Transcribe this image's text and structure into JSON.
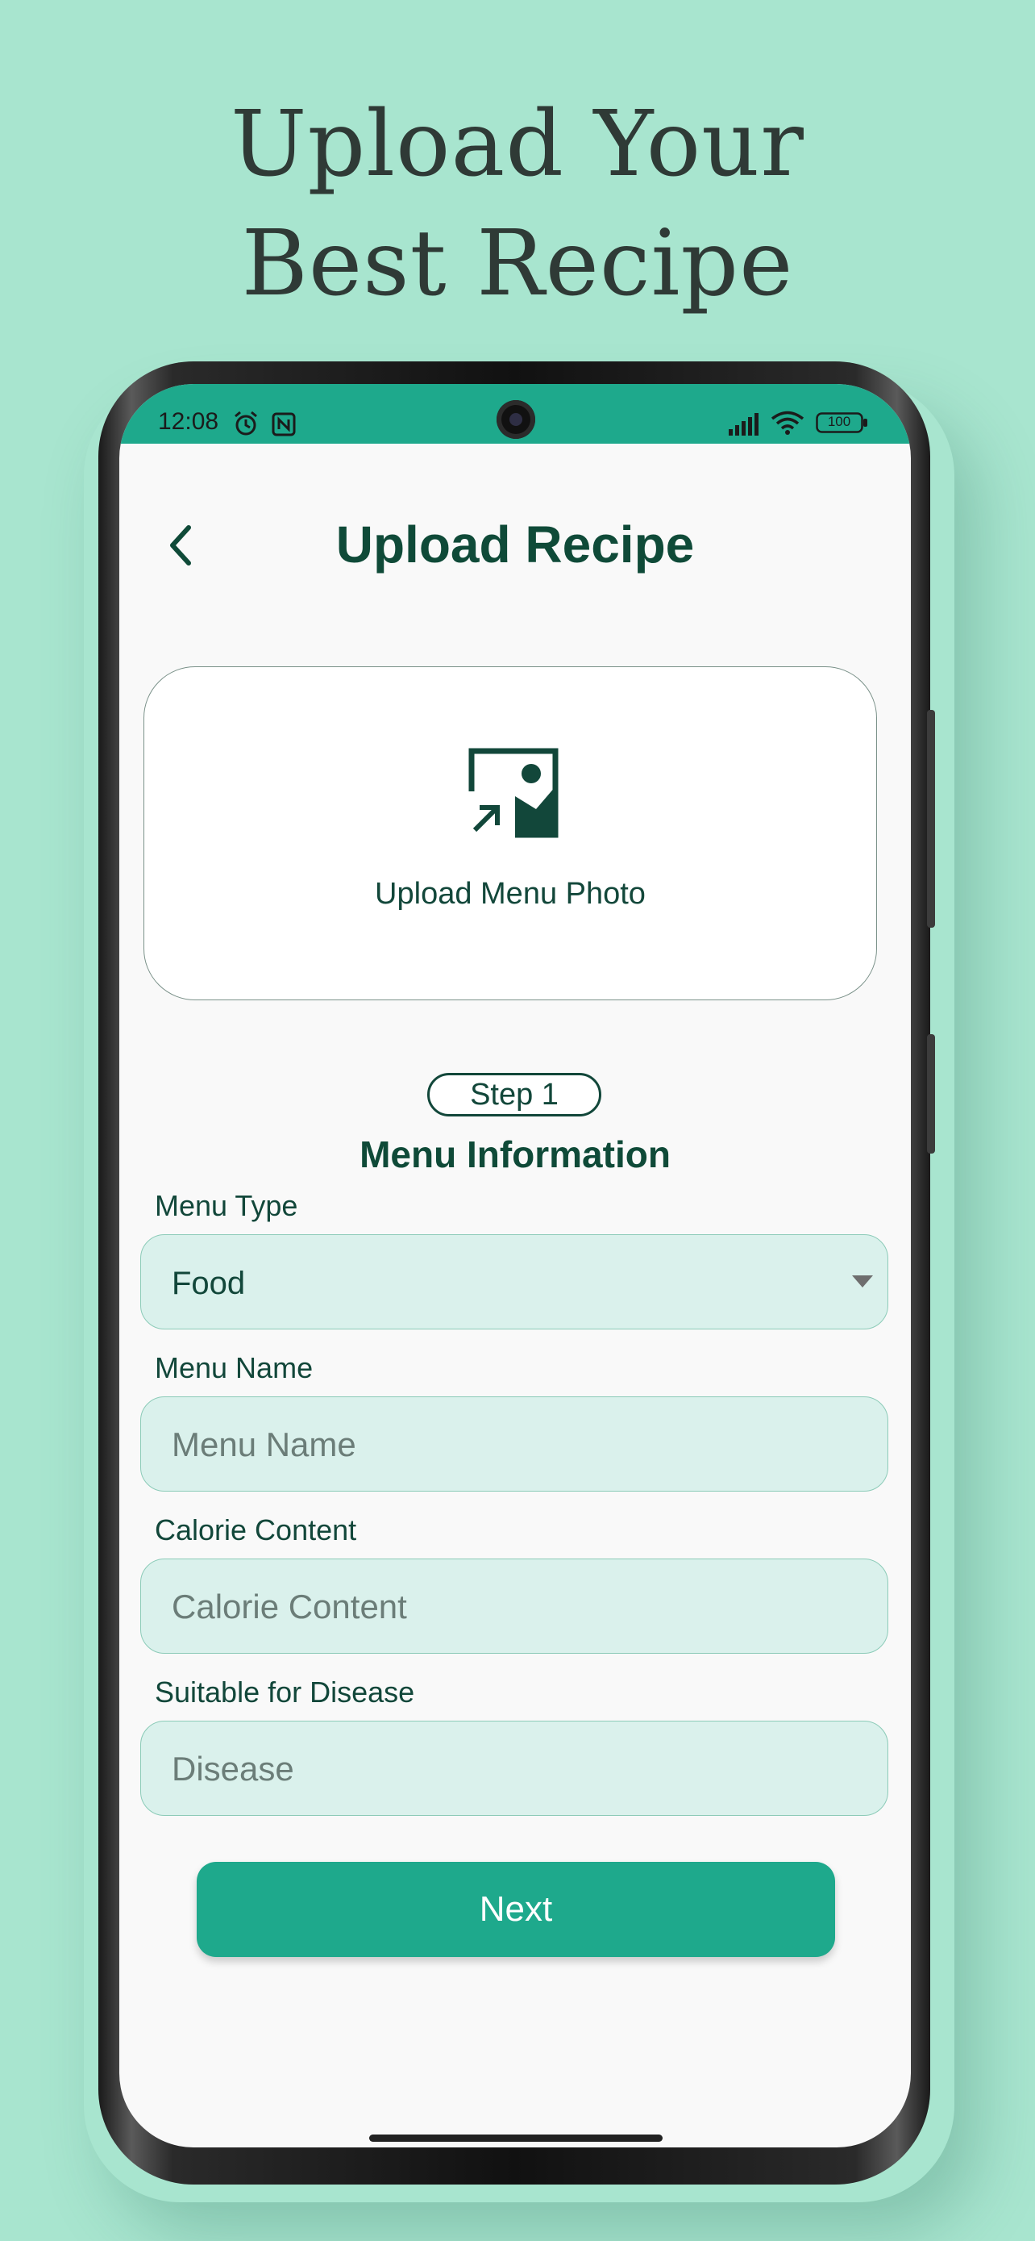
{
  "headline": {
    "line1": "Upload Your",
    "line2": "Best Recipe"
  },
  "status_bar": {
    "time": "12:08",
    "battery": "100",
    "icons": [
      "alarm-icon",
      "nfc-icon",
      "signal-icon",
      "wifi-icon",
      "battery-icon"
    ]
  },
  "header": {
    "title": "Upload Recipe",
    "back_icon": "chevron-left-icon"
  },
  "upload": {
    "label": "Upload Menu Photo",
    "icon": "image-upload-icon"
  },
  "step": {
    "label": "Step 1",
    "title": "Menu Information"
  },
  "form": {
    "menu_type": {
      "label": "Menu Type",
      "value": "Food"
    },
    "menu_name": {
      "label": "Menu Name",
      "placeholder": "Menu Name"
    },
    "calorie": {
      "label": "Calorie Content",
      "placeholder": "Calorie Content"
    },
    "disease": {
      "label": "Suitable for Disease",
      "placeholder": "Disease"
    }
  },
  "actions": {
    "next_label": "Next"
  },
  "colors": {
    "background": "#a8e5cf",
    "accent": "#1ea98c",
    "primary_text": "#0f4a38",
    "field_fill": "#daf1ec"
  }
}
